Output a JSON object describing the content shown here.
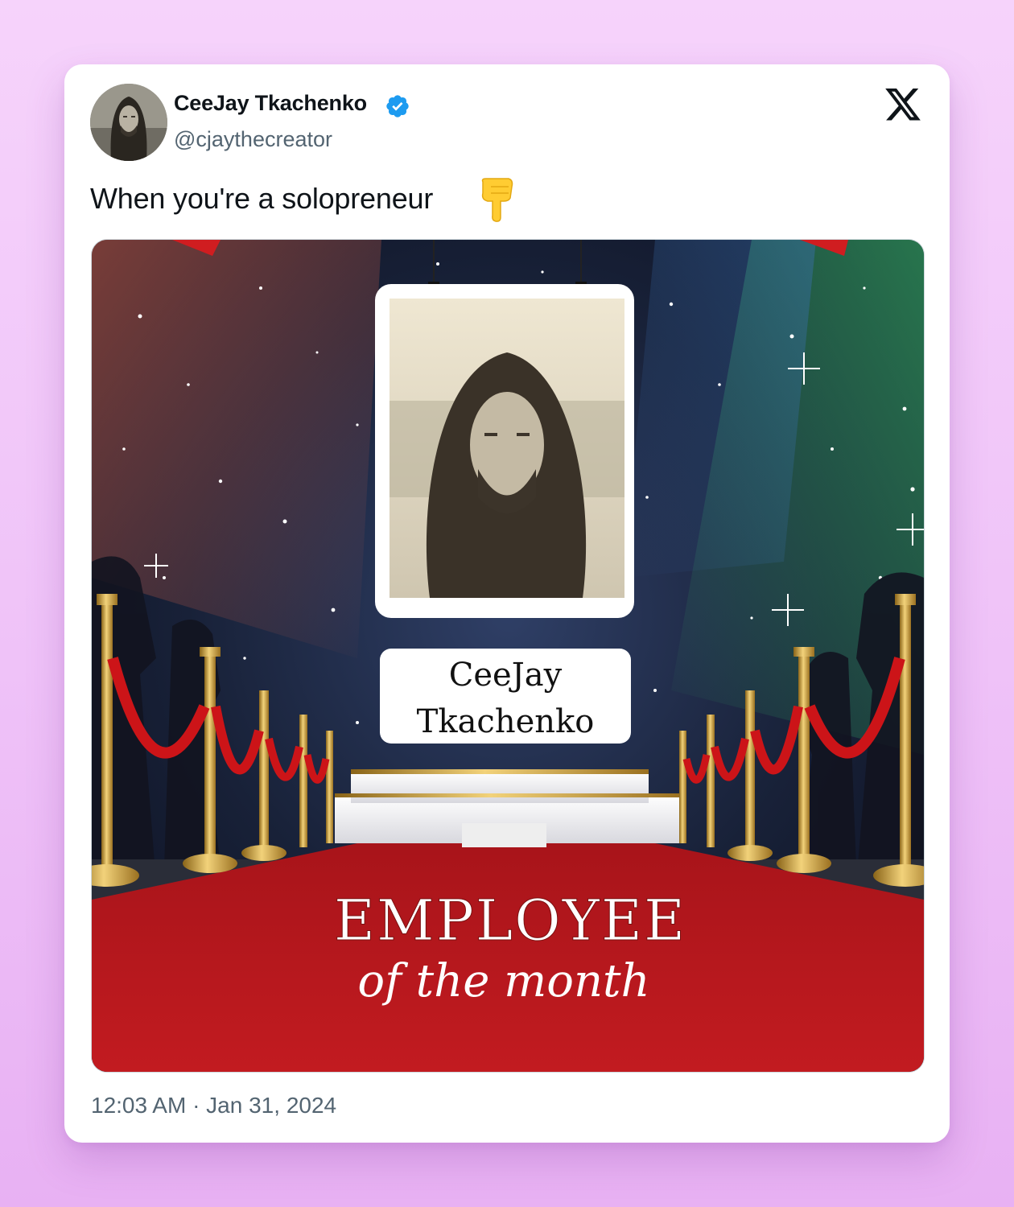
{
  "tweet": {
    "author_name": "CeeJay Tkachenko",
    "author_handle": "@cjaythecreator",
    "text": "When you're a solopreneur",
    "text_emoji": "backhand-index-pointing-down",
    "timestamp": "12:03 AM · Jan 31, 2024",
    "verified": true
  },
  "image": {
    "name_plate_line1": "CeeJay",
    "name_plate_line2": "Tkachenko",
    "title_line1": "EMPLOYEE",
    "title_line2": "of the month"
  },
  "icons": {
    "verified": "verified-badge-icon",
    "brand": "x-logo-icon",
    "emoji": "pointing-down-icon"
  },
  "colors": {
    "page_background": "#f2c8f9",
    "card": "#ffffff",
    "verified_blue": "#1d9bf0",
    "text_primary": "#0f1419",
    "text_secondary": "#536471",
    "carpet_red": "#b8151a",
    "gold": "#d9a830"
  }
}
